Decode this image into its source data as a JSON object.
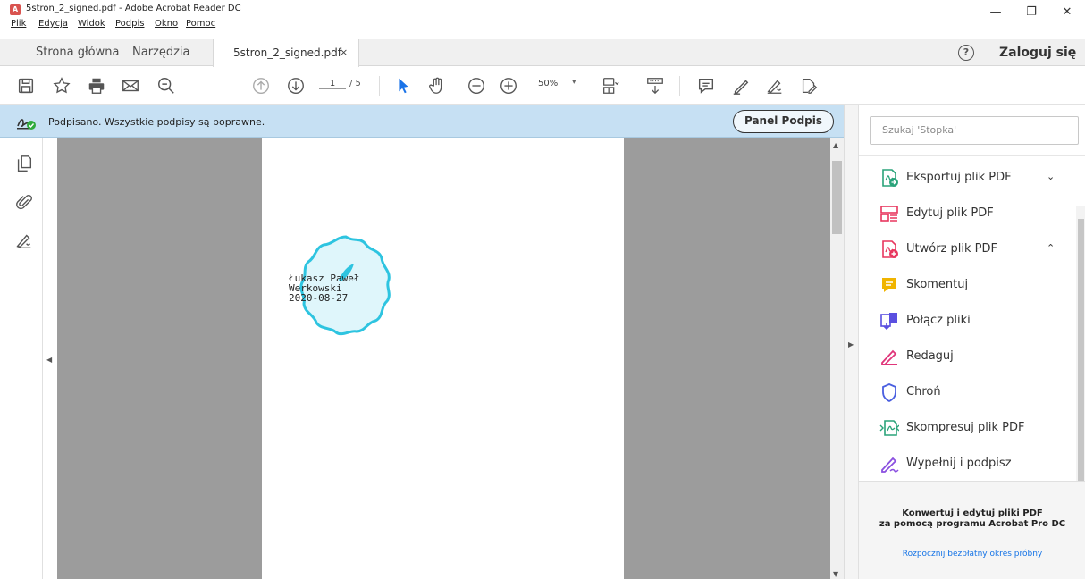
{
  "window": {
    "title": "5stron_2_signed.pdf - Adobe Acrobat Reader DC",
    "app_icon": "acrobat-icon",
    "controls": [
      "minimize",
      "restore",
      "close"
    ]
  },
  "menu": [
    "Plik",
    "Edycja",
    "Widok",
    "Podpis",
    "Okno",
    "Pomoc"
  ],
  "tabs": {
    "home": "Strona główna",
    "tools": "Narzędzia",
    "document": "5stron_2_signed.pdf",
    "close_glyph": "×"
  },
  "account": {
    "help_glyph": "?",
    "login": "Zaloguj się"
  },
  "toolbar": {
    "page_current": "1",
    "page_total": "/ 5",
    "zoom": "50%",
    "zoom_caret": "▾"
  },
  "signature_bar": {
    "message": "Podpisano. Wszystkie podpisy są poprawne.",
    "panel_button": "Panel Podpis"
  },
  "document": {
    "stamp_text": "Łukasz Paweł\nWerkowski\n2020-08-27",
    "stamp_color": "#2ec4e0"
  },
  "right_panel": {
    "search_placeholder": "Szukaj 'Stopka'",
    "tools": [
      {
        "label": "Eksportuj plik PDF",
        "icon": "export-pdf-icon",
        "color": "#2aa37a",
        "caret": "⌄"
      },
      {
        "label": "Edytuj plik PDF",
        "icon": "edit-pdf-icon",
        "color": "#e8365e",
        "caret": ""
      },
      {
        "label": "Utwórz plik PDF",
        "icon": "create-pdf-icon",
        "color": "#e8365e",
        "caret": "⌃"
      },
      {
        "label": "Skomentuj",
        "icon": "comment-icon",
        "color": "#f0b400",
        "caret": ""
      },
      {
        "label": "Połącz pliki",
        "icon": "combine-files-icon",
        "color": "#5a4fe0",
        "caret": ""
      },
      {
        "label": "Redaguj",
        "icon": "redact-icon",
        "color": "#e0357a",
        "caret": ""
      },
      {
        "label": "Chroń",
        "icon": "protect-icon",
        "color": "#4a5fe0",
        "caret": ""
      },
      {
        "label": "Skompresuj plik PDF",
        "icon": "compress-pdf-icon",
        "color": "#2aa37a",
        "caret": ""
      },
      {
        "label": "Wypełnij i podpisz",
        "icon": "fill-sign-icon",
        "color": "#8a4fe0",
        "caret": ""
      }
    ],
    "promo_text": "Konwertuj i edytuj pliki PDF\nza pomocą programu Acrobat Pro DC",
    "trial_link": "Rozpocznij bezpłatny okres próbny"
  }
}
